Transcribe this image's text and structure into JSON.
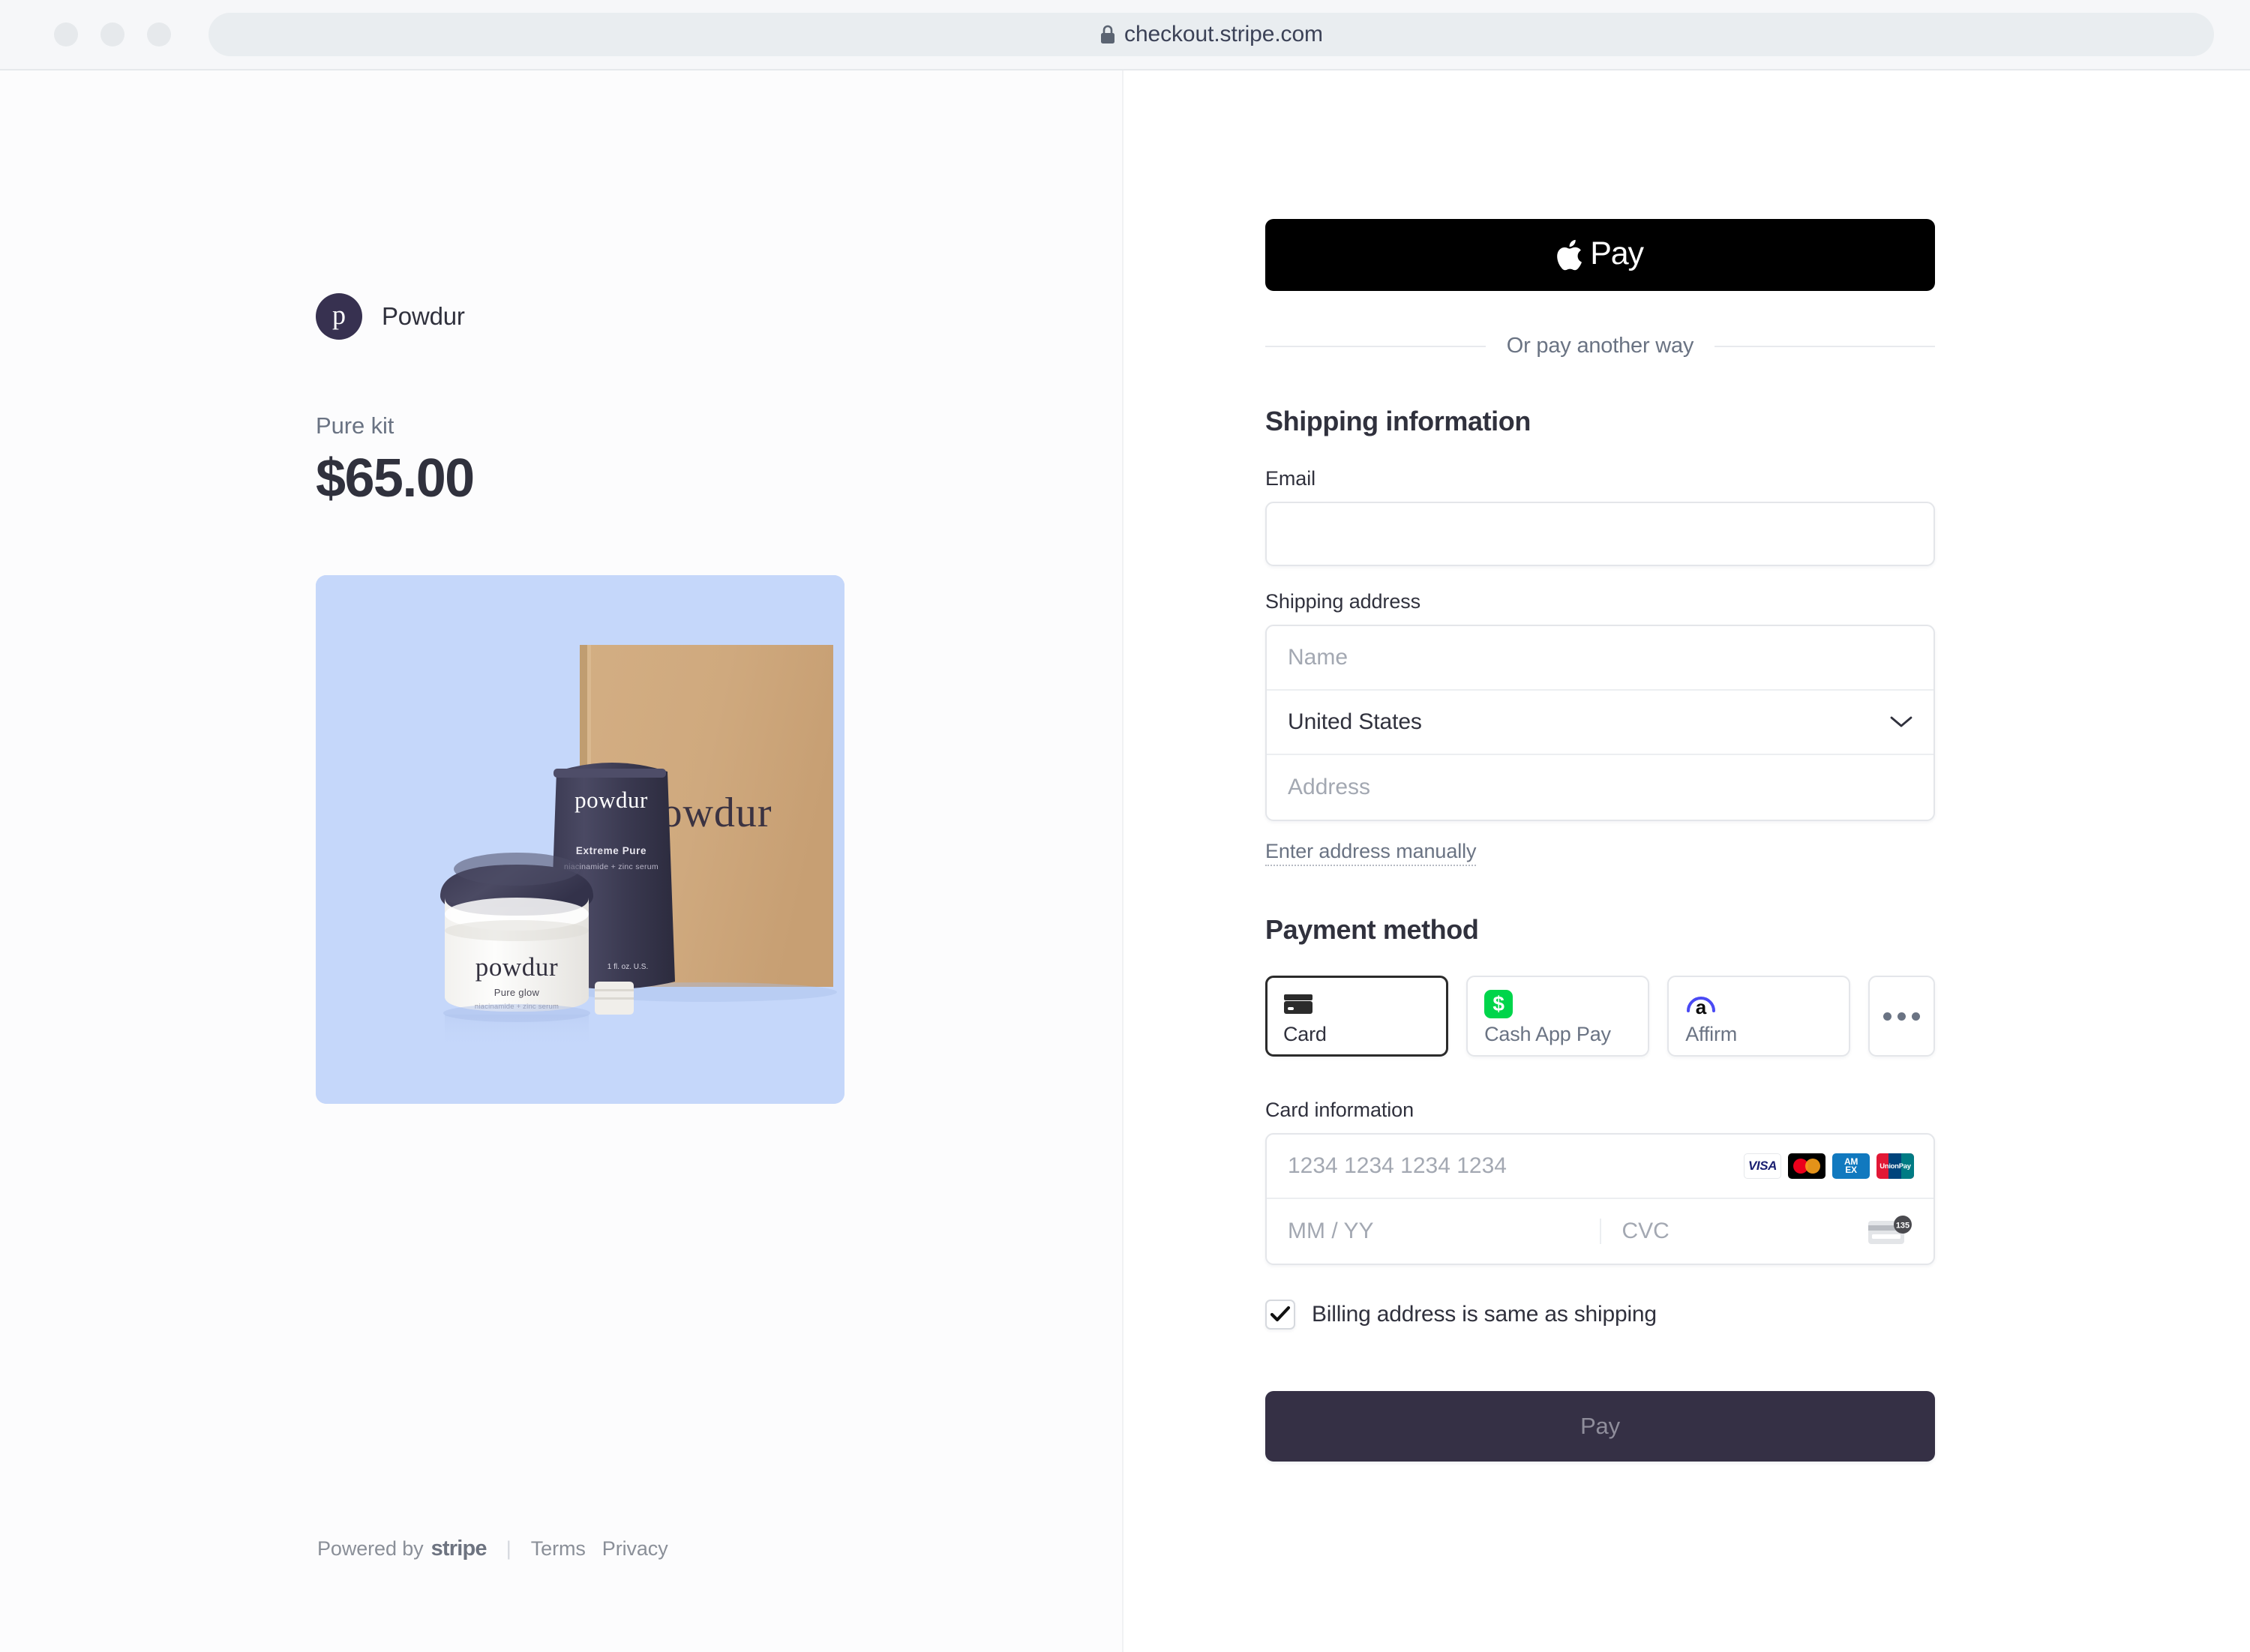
{
  "browser": {
    "url": "checkout.stripe.com",
    "lock_icon": "lock-icon"
  },
  "left": {
    "brand": {
      "logo_letter": "p",
      "name": "Powdur",
      "logo_color": "#373150"
    },
    "product_name": "Pure kit",
    "price": "$65.00",
    "product_image": {
      "background_color": "#c5d7fa",
      "box_label": "powdur",
      "tube_brand": "powdur",
      "tube_name": "Extreme Pure",
      "tube_desc": "niacinamide + zinc serum",
      "tube_volume": "1 fl. oz. U.S.",
      "jar_brand": "powdur",
      "jar_name": "Pure glow",
      "jar_desc": "niacinamide + zinc serum"
    },
    "footer": {
      "powered_by": "Powered by",
      "stripe": "stripe",
      "separator": "|",
      "terms": "Terms",
      "privacy": "Privacy"
    }
  },
  "right": {
    "apple_pay": {
      "label": "Pay",
      "icon": "apple-logo-icon",
      "background_color": "#000000"
    },
    "divider_text": "Or pay another way",
    "shipping": {
      "title": "Shipping information",
      "email_label": "Email",
      "email_value": "",
      "email_placeholder": "",
      "address_label": "Shipping address",
      "name_placeholder": "Name",
      "country_value": "United States",
      "address_placeholder": "Address",
      "manual_link": "Enter address manually"
    },
    "payment_method": {
      "title": "Payment method",
      "options": [
        {
          "label": "Card",
          "icon": "credit-card-icon",
          "selected": true
        },
        {
          "label": "Cash App Pay",
          "icon": "cashapp-icon",
          "selected": false
        },
        {
          "label": "Affirm",
          "icon": "affirm-icon",
          "selected": false
        }
      ],
      "more_label": "•••"
    },
    "card": {
      "title": "Card information",
      "number_placeholder": "1234 1234 1234 1234",
      "number_value": "",
      "expiry_placeholder": "MM / YY",
      "expiry_value": "",
      "cvc_placeholder": "CVC",
      "cvc_value": "",
      "cvc_hint_digits": "135",
      "brands": [
        {
          "name": "VISA",
          "icon": "visa-icon"
        },
        {
          "name": "Mastercard",
          "icon": "mastercard-icon"
        },
        {
          "name": "AMEX",
          "icon": "amex-icon"
        },
        {
          "name": "UnionPay",
          "icon": "unionpay-icon"
        }
      ],
      "amex_line1": "AM",
      "amex_line2": "EX",
      "unionpay_text": "UnionPay"
    },
    "billing_checkbox": {
      "label": "Billing address is same as shipping",
      "checked": true
    },
    "pay_button": {
      "label": "Pay",
      "background_color": "#353045"
    }
  }
}
